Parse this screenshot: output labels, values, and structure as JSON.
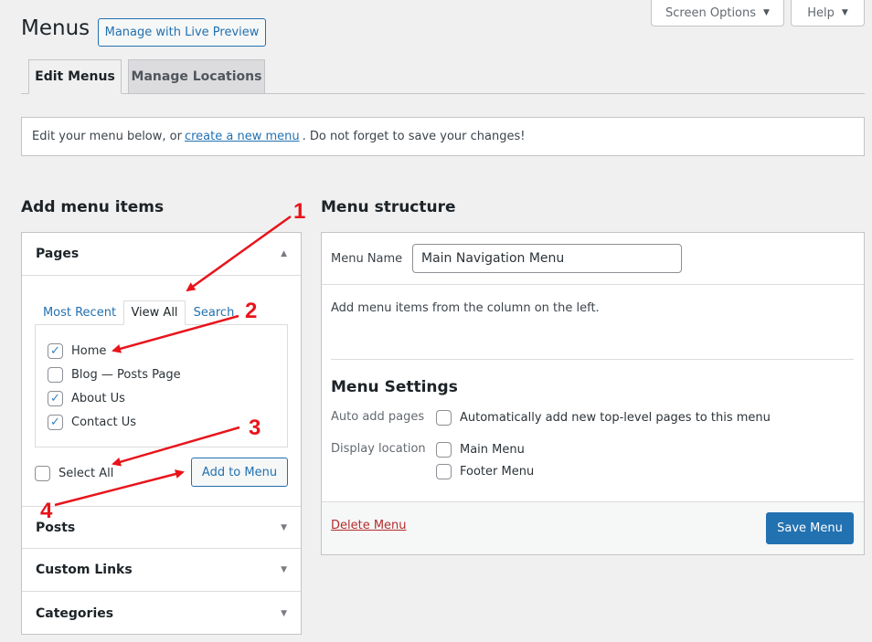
{
  "header": {
    "title": "Menus",
    "live_preview": "Manage with Live Preview",
    "screen_options": "Screen Options",
    "help": "Help"
  },
  "tabs": [
    {
      "label": "Edit Menus",
      "active": true
    },
    {
      "label": "Manage Locations",
      "active": false
    }
  ],
  "notice": {
    "before": "Edit your menu below, or",
    "link": "create a new menu",
    "after": ". Do not forget to save your changes!"
  },
  "add_items": {
    "heading": "Add menu items",
    "pages_title": "Pages",
    "inner_tabs": [
      "Most Recent",
      "View All",
      "Search"
    ],
    "pages": [
      {
        "label": "Home",
        "checked": true
      },
      {
        "label": "Blog — Posts Page",
        "checked": false
      },
      {
        "label": "About Us",
        "checked": true
      },
      {
        "label": "Contact Us",
        "checked": true
      }
    ],
    "select_all": "Select All",
    "add_button": "Add to Menu",
    "other_sections": [
      "Posts",
      "Custom Links",
      "Categories"
    ]
  },
  "structure": {
    "heading": "Menu structure",
    "menu_name_label": "Menu Name",
    "menu_name_value": "Main Navigation Menu",
    "hint": "Add menu items from the column on the left.",
    "settings_heading": "Menu Settings",
    "auto_add_label": "Auto add pages",
    "auto_add_option": "Automatically add new top-level pages to this menu",
    "display_location_label": "Display location",
    "locations": [
      "Main Menu",
      "Footer Menu"
    ],
    "delete_link": "Delete Menu",
    "save_button": "Save Menu"
  },
  "annotations": [
    "1",
    "2",
    "3",
    "4"
  ],
  "colors": {
    "accent": "#2271b1",
    "annotation": "#e8141b",
    "delete": "#b32d2e"
  }
}
